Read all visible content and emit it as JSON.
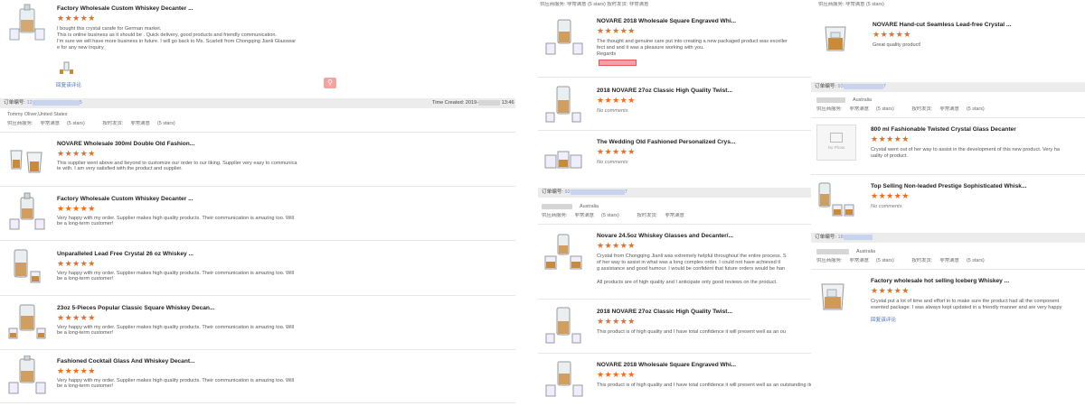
{
  "colors": {
    "star": "#f26a1b",
    "link": "#3a6bc9",
    "order_bar": "#ececec"
  },
  "ui": {
    "stars": "★★★★★",
    "no_comments": "No comments",
    "reply_link": "回复该评论",
    "order_label": "订单编号:",
    "supplier_service": "供应商服务:",
    "on_time_delivery": "按时发货:",
    "very_satisfied": "非常满意",
    "five_stars": "(5 stars)",
    "time_created": "Time Created: 2019-",
    "time_suffix": "13:46",
    "no_photo": "No Photo",
    "search_icon": "search-icon"
  },
  "left": {
    "top_review": {
      "title": "Factory Wholesale Custom Whiskey Decanter ...",
      "lines": [
        "I bought this crystal carafe for German market.",
        "This is online business as it should be . Quick delivery, good products and friendly communication.",
        "I'm sure we will have more business in future. I will go back to Ms. Scarlett from Chongqing Jianli Glasswar",
        "e for any new inquiry"
      ]
    },
    "order": {
      "number_prefix": "12",
      "number_suffix": "5",
      "buyer": "Tommy Oliver,United States"
    },
    "reviews": [
      {
        "title": "NOVARE Wholesale 300ml Double Old Fashion...",
        "lines": [
          "This supplier went above and beyond to customize our order to our liking. Supplier very easy to communica",
          "te with. I am very satisfied with the product and supplier."
        ]
      },
      {
        "title": "Factory Wholesale Custom Whiskey Decanter ...",
        "lines": [
          "Very happy with my order. Supplier makes high quality products. Their communication is amazing too. Will",
          "be a long-term customer!"
        ]
      },
      {
        "title": "Unparalleled Lead Free Crystal 26 oz Whiskey ...",
        "lines": [
          "Very happy with my order. Supplier makes high quality products. Their communication is amazing too. Will",
          "be a long-term customer!"
        ]
      },
      {
        "title": "23oz 5-Pieces Popular Classic Square Whiskey Decan...",
        "lines": [
          "Very happy with my order. Supplier makes high quality products. Their communication is amazing too. Will",
          "be a long-term customer!"
        ]
      },
      {
        "title": "Fashioned Cocktail Glass And Whiskey Decant...",
        "lines": [
          "Very happy with my order. Supplier makes high quality products. Their communication is amazing too. Will",
          "be a long-term customer!"
        ]
      }
    ]
  },
  "middle": {
    "header_meta": "供应商服务:    非常满意      (5 stars)        按时发货:    非常满意",
    "reviews_top": [
      {
        "title": "NOVARE 2018 Wholesale Square Engraved Whi...",
        "lines": [
          "The thought and genuine care put into creating a new packaged product was exceller",
          "fect and and it was a pleasure working with you.",
          "Regards"
        ]
      },
      {
        "title": "2018 NOVARE 27oz Classic High Quality Twist...",
        "lines": []
      },
      {
        "title": "The Wedding Old Fashioned Personalized Crys...",
        "lines": []
      }
    ],
    "order": {
      "number_prefix": "92",
      "number_suffix": "7",
      "buyer": "Australia"
    },
    "reviews_bottom": [
      {
        "title": "Novare 24.5oz Whiskey Glasses and Decanter/...",
        "lines": [
          "Crystal from Chongqing Jianli was extremely helpful throughout the entire process. S",
          "of her way to assist in what was a long complex order. I could not have achieved tl",
          "g assistance and good humour. I would be confident that future orders would be han",
          "",
          "All products are of high quality and I anticipate only good reviews on the product."
        ]
      },
      {
        "title": "2018 NOVARE 27oz Classic High Quality Twist...",
        "lines": [
          "This product is of high quality and I have total confidence it will present well as an ou"
        ]
      },
      {
        "title": "NOVARE 2018 Wholesale Square Engraved Whi...",
        "lines": [
          "This product is of high quality and I have total confidence it will present well as an outstanding item"
        ]
      }
    ]
  },
  "right": {
    "header_meta": "供应商服务:    非常满意      (5 stars)",
    "top_review": {
      "title": "NOVARE Hand-cut Seamless Lead-free Crystal ...",
      "lines": [
        "Great quality product!"
      ]
    },
    "order1": {
      "number_prefix": "93",
      "number_suffix": "7",
      "buyer": "Australia"
    },
    "order1_reviews": [
      {
        "title": "800 ml Fashionable Twisted Crystal Glass Decanter",
        "lines": [
          "Crystal went out of her way to assist in the development of this new product. Very ha",
          "uality of product."
        ]
      },
      {
        "title": "Top Selling Non-leaded Prestige Sophisticated Whisk...",
        "lines": []
      }
    ],
    "order2": {
      "number_prefix": "18",
      "number_suffix": "",
      "buyer": "Australia"
    },
    "order2_review": {
      "title": "Factory wholesale hot selling Iceberg Whiskey ...",
      "lines": [
        "Crystal put a lot of time and effort in to make sure the product had all the component",
        "esented package. I was always kept updated in a friendly manner and are very happy"
      ]
    }
  }
}
